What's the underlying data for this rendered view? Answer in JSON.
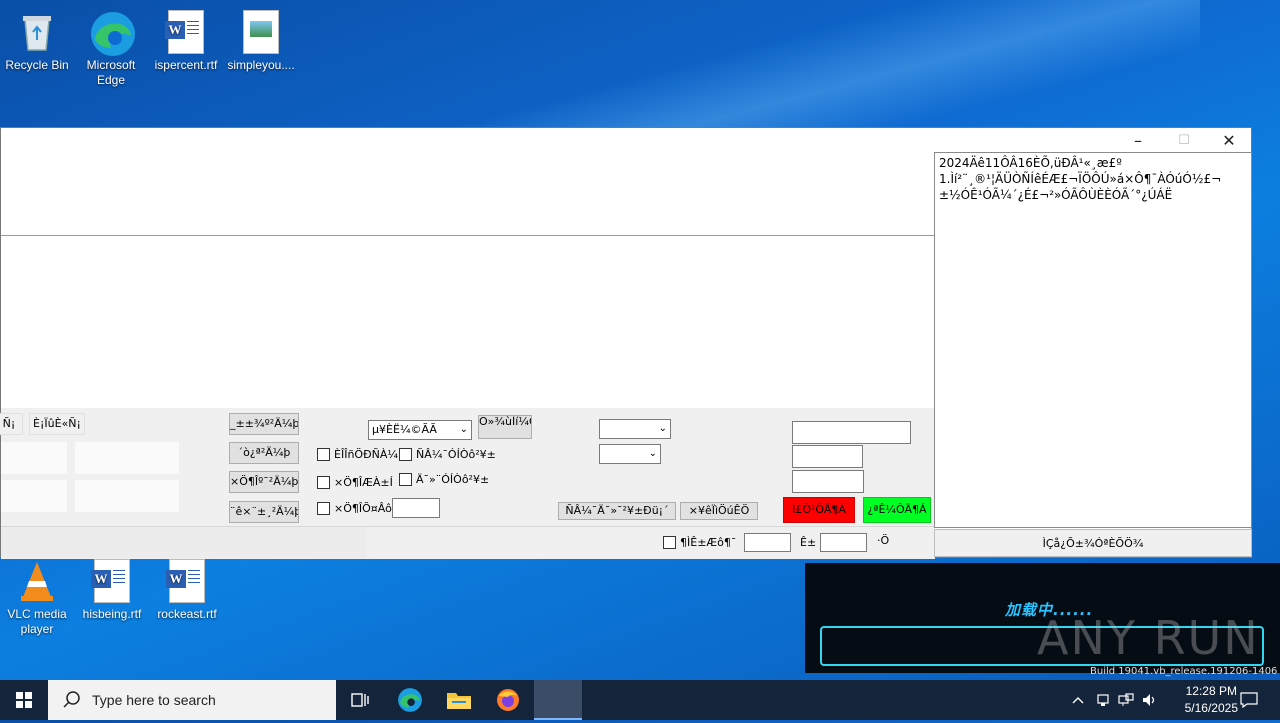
{
  "desktop": {
    "icons_top": [
      {
        "label": "Recycle Bin",
        "icon": "recycle-bin-icon"
      },
      {
        "label": "Microsoft Edge",
        "icon": "edge-icon"
      },
      {
        "label": "ispercent.rtf",
        "icon": "word-document-icon"
      },
      {
        "label": "simpleyou....",
        "icon": "image-document-icon"
      }
    ],
    "icons_bottom": [
      {
        "label": "VLC media player",
        "icon": "vlc-icon"
      },
      {
        "label": "hisbeing.rtf",
        "icon": "word-document-icon"
      },
      {
        "label": "rockeast.rtf",
        "icon": "word-document-icon"
      }
    ]
  },
  "app_window": {
    "controls": {
      "minimize": "–",
      "maximize": "☐",
      "close": "✕"
    },
    "left_buttons": {
      "partial": "Ñ¡",
      "btn1": "È¡ÏûÈ«Ñ¡"
    },
    "action_buttons": [
      "_±±¾º²Ä¼þ",
      "´ò¿ª²Ä¼þ",
      "×Ö¶Îº¯²Ä¼þ",
      "¨ê×¨±¸²Ä¼þ"
    ],
    "combo1": "µ¥ÈË¼©ÃÃ",
    "small_button": "Ö»¾ùÌí¼Ó",
    "checkboxes": [
      {
        "label": "ÈÎÎñÖÐÑÀ¼",
        "checked": false
      },
      {
        "label": "ÑÂ¼¯ÓÍÒô²¥±",
        "checked": false
      },
      {
        "label": "×Ö¶ÎÆÀ±Í",
        "checked": false
      },
      {
        "label": "Ä¯»¨ÓÍÒô²¥±",
        "checked": false
      },
      {
        "label": "×Ö¶ÎÕ¤Âô",
        "checked": false
      }
    ],
    "bottom_buttons": {
      "b1": "ÑÂ¼¯Ä¯»¯²¥±Ðü¡´",
      "b2": "×¥êÏìÖúÊÖ"
    },
    "red_button": "Í£Ö¹ÔÄ¶Á",
    "green_button": "¿ªÊ¼ÔÄ¶Á",
    "status": {
      "checkbox": "¶ÌÊ±Æô¶¯",
      "label_mid": "Ê±",
      "label_end": "·Ö"
    }
  },
  "log_window": {
    "lines": [
      "2024Äê11ÔÂ16ÈÕ,üÐÂ¹«¸æ£º",
      "   1.Ìí²¨¸®¹¦ÄÜÒÑÍêÉÆ£¬ÏÖÔÚ»á×Ô¶¯À­ÓúÓ½£¬",
      "±½ÓÊ¹ÓÃ¼´¿É£¬²»ÓÃÔÙÈÈÓÃ´°¿ÚÁË"
    ],
    "button": "ÌÇå¿Õ±¾ÓªÈÕÖ¾"
  },
  "overlay": {
    "loading_text": "加载中......",
    "watermark": "ANY RUN",
    "build": "Build 19041.vb_release.191206-1406"
  },
  "taskbar": {
    "search_placeholder": "Type here to search",
    "time": "12:28 PM",
    "date": "5/16/2025"
  },
  "colors": {
    "red_button": "#ff0000",
    "green_button": "#00ff22",
    "taskbar": "#14243a",
    "desktop": "#0f6ad1"
  }
}
